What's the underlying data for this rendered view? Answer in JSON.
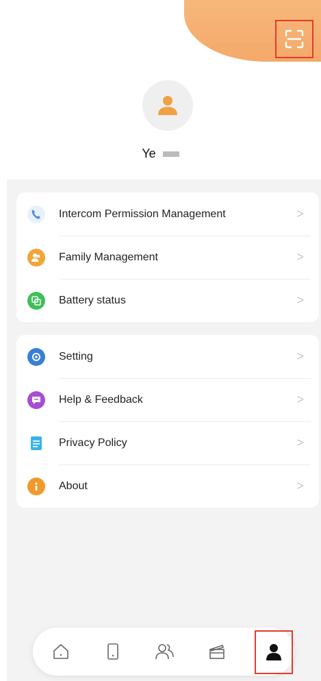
{
  "user": {
    "name": "Ye"
  },
  "colors": {
    "accent": "#f4a96a",
    "highlight": "#e33a2c"
  },
  "header": {
    "scan_icon": "scan-icon",
    "avatar_icon": "person-icon"
  },
  "menu_group_1": [
    {
      "label": "Intercom Permission Management",
      "icon": "intercom-icon",
      "chevron": ">"
    },
    {
      "label": "Family Management",
      "icon": "family-icon",
      "chevron": ">"
    },
    {
      "label": "Battery status",
      "icon": "battery-icon",
      "chevron": ">"
    }
  ],
  "menu_group_2": [
    {
      "label": "Setting",
      "icon": "settings-icon",
      "chevron": ">"
    },
    {
      "label": "Help & Feedback",
      "icon": "feedback-icon",
      "chevron": ">"
    },
    {
      "label": "Privacy Policy",
      "icon": "document-icon",
      "chevron": ">"
    },
    {
      "label": "About",
      "icon": "info-icon",
      "chevron": ">"
    }
  ],
  "tabs": [
    {
      "icon": "home-icon",
      "active": false
    },
    {
      "icon": "device-icon",
      "active": false
    },
    {
      "icon": "contacts-icon",
      "active": false
    },
    {
      "icon": "clapperboard-icon",
      "active": false
    },
    {
      "icon": "profile-icon",
      "active": true
    }
  ]
}
